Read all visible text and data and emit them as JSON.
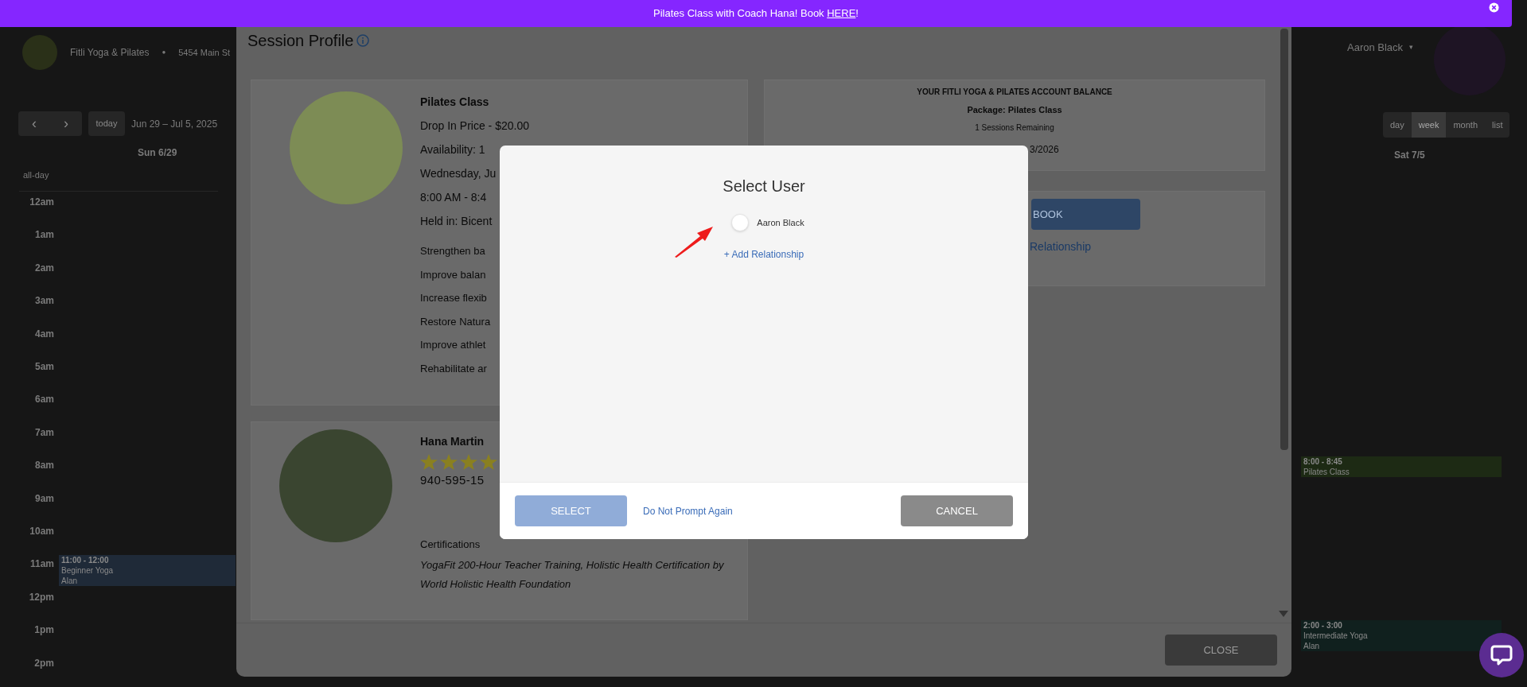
{
  "banner": {
    "text": "Pilates Class with Coach Hana! Book ",
    "link": "HERE",
    "suffix": "!"
  },
  "studio": {
    "name": "Fitli Yoga & Pilates",
    "separator": "●",
    "address": "5454 Main St"
  },
  "calendar": {
    "prev": "‹",
    "next": "›",
    "today": "today",
    "range": "Jun 29 – Jul 5, 2025",
    "day_left": "Sun 6/29",
    "day_right": "Sat 7/5",
    "all_day": "all-day",
    "hours": [
      "12am",
      "1am",
      "2am",
      "3am",
      "4am",
      "5am",
      "6am",
      "7am",
      "8am",
      "9am",
      "10am",
      "11am",
      "12pm",
      "1pm",
      "2pm"
    ],
    "views": [
      {
        "label": "day",
        "selected": false
      },
      {
        "label": "week",
        "selected": true
      },
      {
        "label": "month",
        "selected": false
      },
      {
        "label": "list",
        "selected": false
      }
    ],
    "sunday_events": [
      {
        "time": "11:00 - 12:00",
        "title": "Beginner Yoga",
        "instructor": "Alan",
        "color": "#1f2a38"
      }
    ],
    "saturday_events": [
      {
        "time": "8:00 - 8:45",
        "title": "Pilates Class",
        "color": "#1d2a14"
      },
      {
        "time": "2:00 - 3:00",
        "title": "Intermediate Yoga",
        "instructor": "Alan",
        "color": "#10201e"
      }
    ]
  },
  "user_menu": {
    "name": "Aaron Black",
    "caret": "▾"
  },
  "session_profile": {
    "title": "Session Profile",
    "class": {
      "name": "Pilates Class",
      "details": [
        "Drop In Price - $20.00",
        "Availability: 1",
        "Wednesday, Ju",
        "8:00 AM - 8:4",
        "Held in: Bicent"
      ],
      "benefits": [
        "Strengthen ba",
        "Improve balan",
        "Increase flexib",
        "Restore Natura",
        "Improve athlet",
        "Rehabilitate ar"
      ]
    },
    "balance": {
      "heading": "YOUR FITLI YOGA & PILATES ACCOUNT BALANCE",
      "package": "Package: Pilates Class",
      "remaining": "1 Sessions Remaining",
      "expiry": "3/2026"
    },
    "book_button": "BOOK",
    "relationship_link": "Relationship",
    "trainer": {
      "name": "Hana Martin",
      "stars": 4,
      "phone": "940-595-15",
      "cert_label": "Certifications",
      "certifications": "YogaFit 200-Hour Teacher Training, Holistic Health Certification by World Holistic Health Foundation"
    },
    "close_button": "CLOSE"
  },
  "select_user": {
    "title": "Select User",
    "users": [
      {
        "name": "Aaron Black",
        "selected": false
      }
    ],
    "add_link": "+ Add Relationship",
    "select_button": "SELECT",
    "select_disabled": true,
    "dont_prompt": "Do Not Prompt Again",
    "cancel_button": "CANCEL"
  }
}
